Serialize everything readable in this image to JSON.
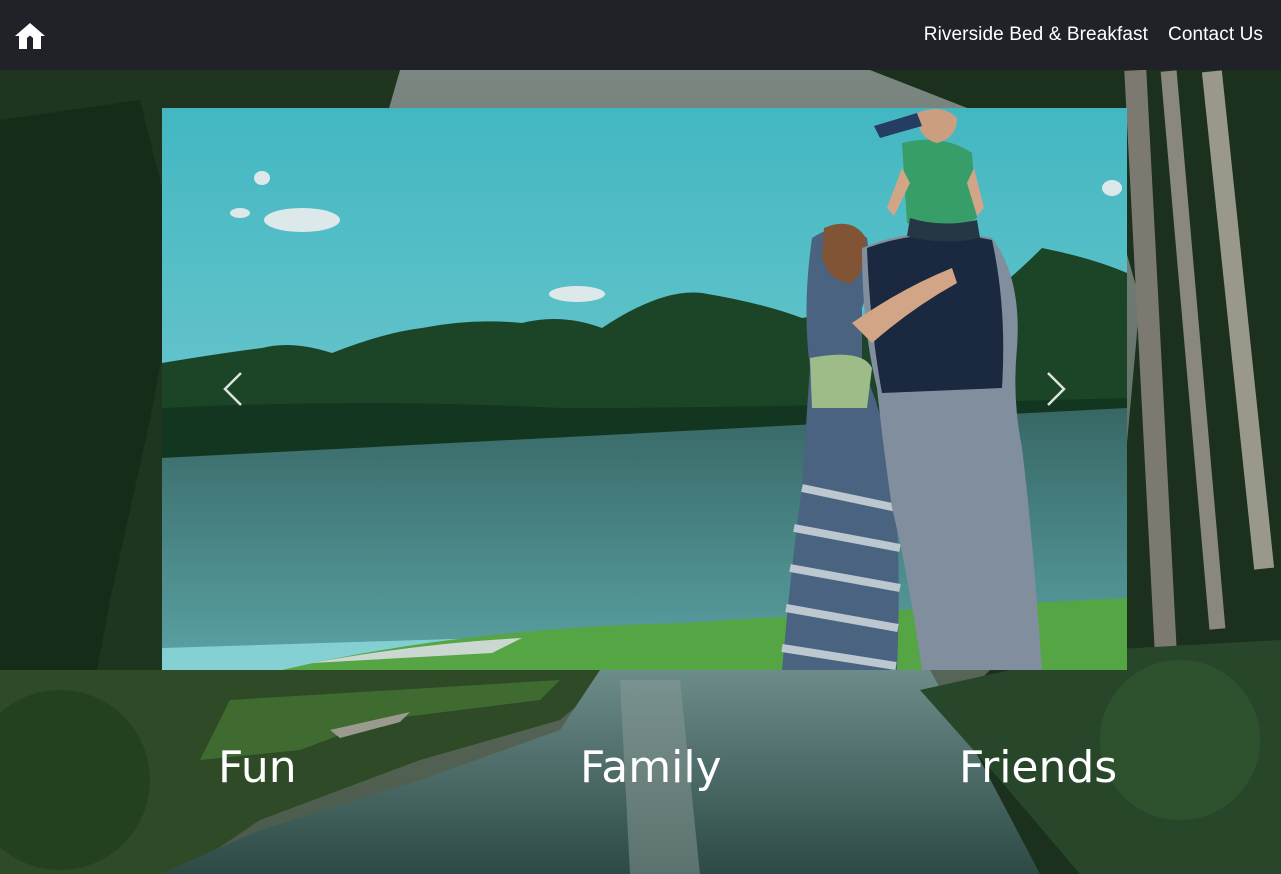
{
  "navbar": {
    "home_icon": "home-icon",
    "links": [
      {
        "label": "Riverside Bed & Breakfast"
      },
      {
        "label": "Contact Us"
      }
    ]
  },
  "carousel": {
    "prev_icon": "chevron-left-icon",
    "next_icon": "chevron-right-icon",
    "slide_description_icon": "family-by-river-photo"
  },
  "taglines": [
    "Fun",
    "Family",
    "Friends"
  ],
  "colors": {
    "navbar_bg": "#202227",
    "text": "#ffffff"
  }
}
